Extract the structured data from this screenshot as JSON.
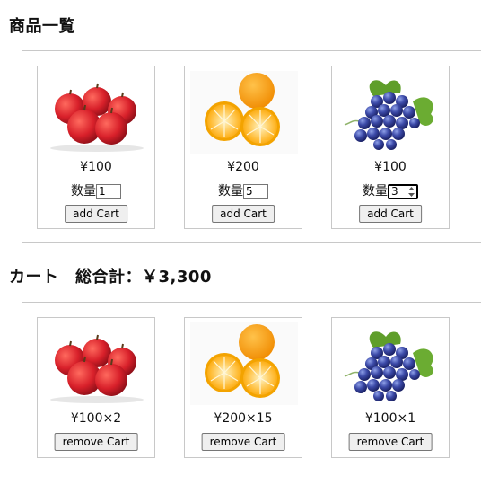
{
  "products_title": "商品一覧",
  "products": [
    {
      "fruit": "apple",
      "price": "¥100",
      "qty_label": "数量",
      "qty": "1",
      "button": "add Cart"
    },
    {
      "fruit": "orange",
      "price": "¥200",
      "qty_label": "数量",
      "qty": "5",
      "button": "add Cart"
    },
    {
      "fruit": "grape",
      "price": "¥100",
      "qty_label": "数量",
      "qty": "3",
      "button": "add Cart"
    }
  ],
  "cart_title": "カート　総合計：￥3,300",
  "cart": [
    {
      "fruit": "apple",
      "line": "¥100×2",
      "button": "remove Cart"
    },
    {
      "fruit": "orange",
      "line": "¥200×15",
      "button": "remove Cart"
    },
    {
      "fruit": "grape",
      "line": "¥100×1",
      "button": "remove Cart"
    }
  ]
}
